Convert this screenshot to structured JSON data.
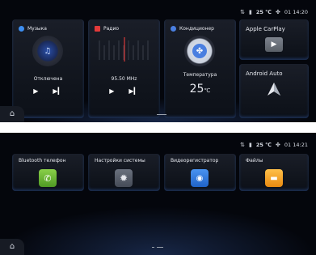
{
  "screen1": {
    "status": {
      "temperature": "25",
      "unit": "℃",
      "time": "01 14:20"
    },
    "music": {
      "title": "Музыка",
      "status": "Отключена"
    },
    "radio": {
      "title": "Радио",
      "frequency": "95.50 MHz"
    },
    "ac": {
      "title": "Кондиционер",
      "temp_label": "Температура",
      "temp_value": "25",
      "temp_unit": "℃"
    },
    "carplay": {
      "title": "Apple CarPlay"
    },
    "android": {
      "title": "Android Auto"
    }
  },
  "screen2": {
    "status": {
      "temperature": "25",
      "unit": "℃",
      "time": "01 14:21"
    },
    "apps": [
      {
        "title": "Bluetooth телефон",
        "icon": "phone-icon",
        "color": "#6fbf3a"
      },
      {
        "title": "Настройки системы",
        "icon": "gear-icon",
        "color": "#5a6170"
      },
      {
        "title": "Видеорегистратор",
        "icon": "dashcam-icon",
        "color": "#2f7fe6"
      },
      {
        "title": "Файлы",
        "icon": "folder-icon",
        "color": "#f0a21a"
      }
    ]
  },
  "colors": {
    "accent_blue": "#2f7fe6",
    "background": "#04060c",
    "tile": "#141820"
  }
}
